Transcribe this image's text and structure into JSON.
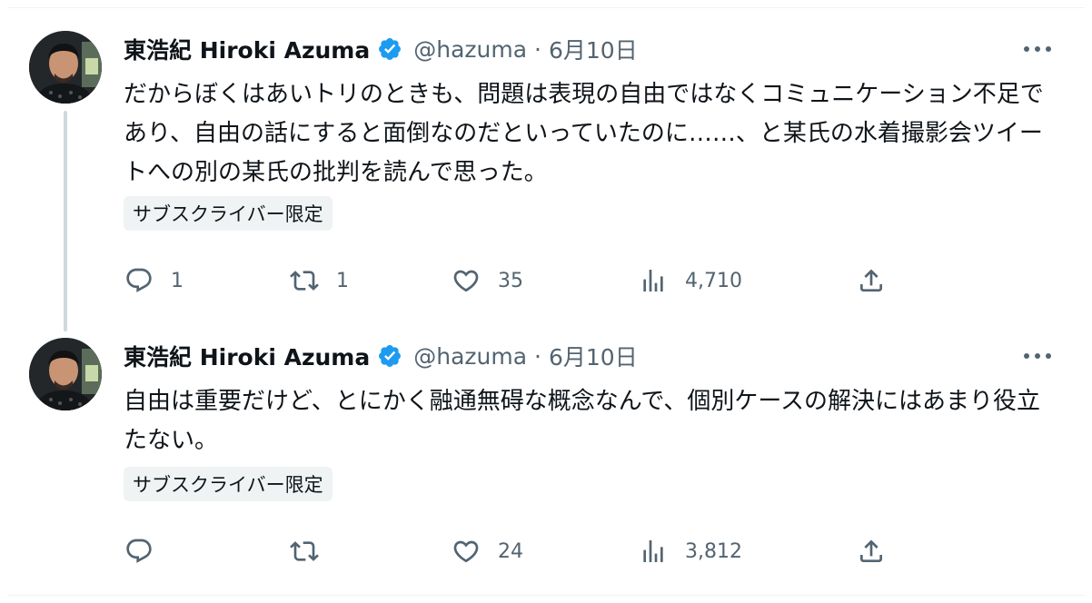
{
  "colors": {
    "text": "#0f1419",
    "secondary": "#536471",
    "verified": "#1d9bf0",
    "badge_bg": "#eff3f4",
    "thread_line": "#cfd9de"
  },
  "tweets": [
    {
      "author": {
        "name": "東浩紀 Hiroki Azuma",
        "handle": "@hazuma",
        "verified_icon": "verified-badge-icon"
      },
      "separator": "·",
      "date": "6月10日",
      "text": "だからぼくはあいトリのときも、問題は表現の自由ではなくコミュニケーション不足であり、自由の話にすると面倒なのだといっていたのに……、と某氏の水着撮影会ツイートへの別の某氏の批判を読んで思った。",
      "badge": "サブスクライバー限定",
      "stats": {
        "replies": "1",
        "retweets": "1",
        "likes": "35",
        "views": "4,710"
      }
    },
    {
      "author": {
        "name": "東浩紀 Hiroki Azuma",
        "handle": "@hazuma",
        "verified_icon": "verified-badge-icon"
      },
      "separator": "·",
      "date": "6月10日",
      "text": "自由は重要だけど、とにかく融通無碍な概念なんで、個別ケースの解決にはあまり役立たない。",
      "badge": "サブスクライバー限定",
      "stats": {
        "replies": "",
        "retweets": "",
        "likes": "24",
        "views": "3,812"
      }
    }
  ],
  "icons": [
    "avatar",
    "verified-badge-icon",
    "more-icon",
    "reply-icon",
    "retweet-icon",
    "like-icon",
    "views-icon",
    "share-icon"
  ]
}
